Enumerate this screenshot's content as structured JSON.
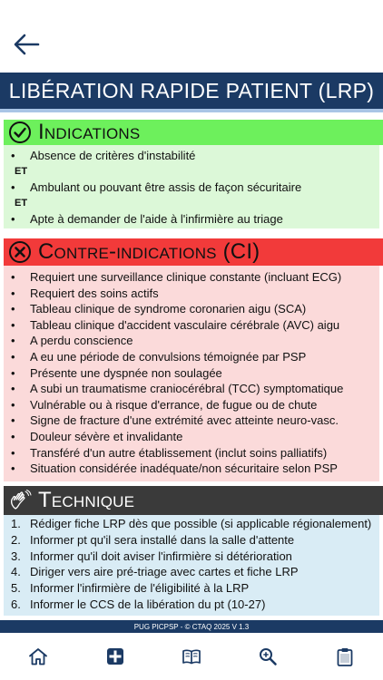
{
  "header": {
    "title": "LIBÉRATION RAPIDE PATIENT (LRP)",
    "back_icon": "arrow-left-icon"
  },
  "indications": {
    "title": "Indications",
    "icon": "check-circle-icon",
    "color": "#6df05c",
    "items": [
      "Absence de critères d'instabilité",
      "Ambulant ou pouvant être assis de façon sécuritaire",
      "Apte à demander de l'aide à l'infirmière au triage"
    ],
    "separator": "ET"
  },
  "contraindications": {
    "title": "Contre-indications (CI)",
    "icon": "x-circle-icon",
    "color": "#f23a3a",
    "items": [
      "Requiert une surveillance clinique constante (incluant ECG)",
      "Requiert des soins actifs",
      "Tableau clinique de syndrome coronarien aigu (SCA)",
      "Tableau clinique d'accident vasculaire cérébrale (AVC) aigu",
      "A perdu conscience",
      "A eu une période de convulsions témoignée par PSP",
      "Présente une dyspnée non soulagée",
      "A subi un traumatisme craniocérébral (TCC) symptomatique",
      "Vulnérable ou à risque d'errance, de fugue ou de chute",
      "Signe de fracture d'une extrémité avec atteinte neuro-vasc.",
      "Douleur sévère et invalidante",
      "Transféré d'un autre établissement (inclut soins palliatifs)",
      "Situation considérée inadéquate/non sécuritaire selon PSP"
    ]
  },
  "technique": {
    "title": "Technique",
    "icon": "waving-hand-icon",
    "color": "#3a3a3a",
    "steps": [
      {
        "num": "1.",
        "text": "Rédiger fiche LRP dès que possible (si applicable régionalement)"
      },
      {
        "num": "2.",
        "text": "Informer pt qu'il sera installé dans la salle d'attente"
      },
      {
        "num": "3.",
        "text": "Informer qu'il doit aviser l'infirmière si détérioration"
      },
      {
        "num": "4.",
        "text": "Diriger vers aire pré-triage avec cartes et fiche LRP"
      },
      {
        "num": "5.",
        "text": "Informer l'infirmière de l'éligibilité à la LRP"
      },
      {
        "num": "6.",
        "text": "Informer le CCS de la libération du pt (10-27)"
      }
    ]
  },
  "footer": {
    "text": "PUG PICPSP - © CTAQ 2025 V 1.3"
  },
  "nav": {
    "items": [
      {
        "name": "home",
        "icon": "home-icon"
      },
      {
        "name": "medical",
        "icon": "medical-cross-icon"
      },
      {
        "name": "book",
        "icon": "book-icon"
      },
      {
        "name": "search",
        "icon": "zoom-search-icon"
      },
      {
        "name": "clipboard",
        "icon": "clipboard-icon"
      }
    ]
  }
}
